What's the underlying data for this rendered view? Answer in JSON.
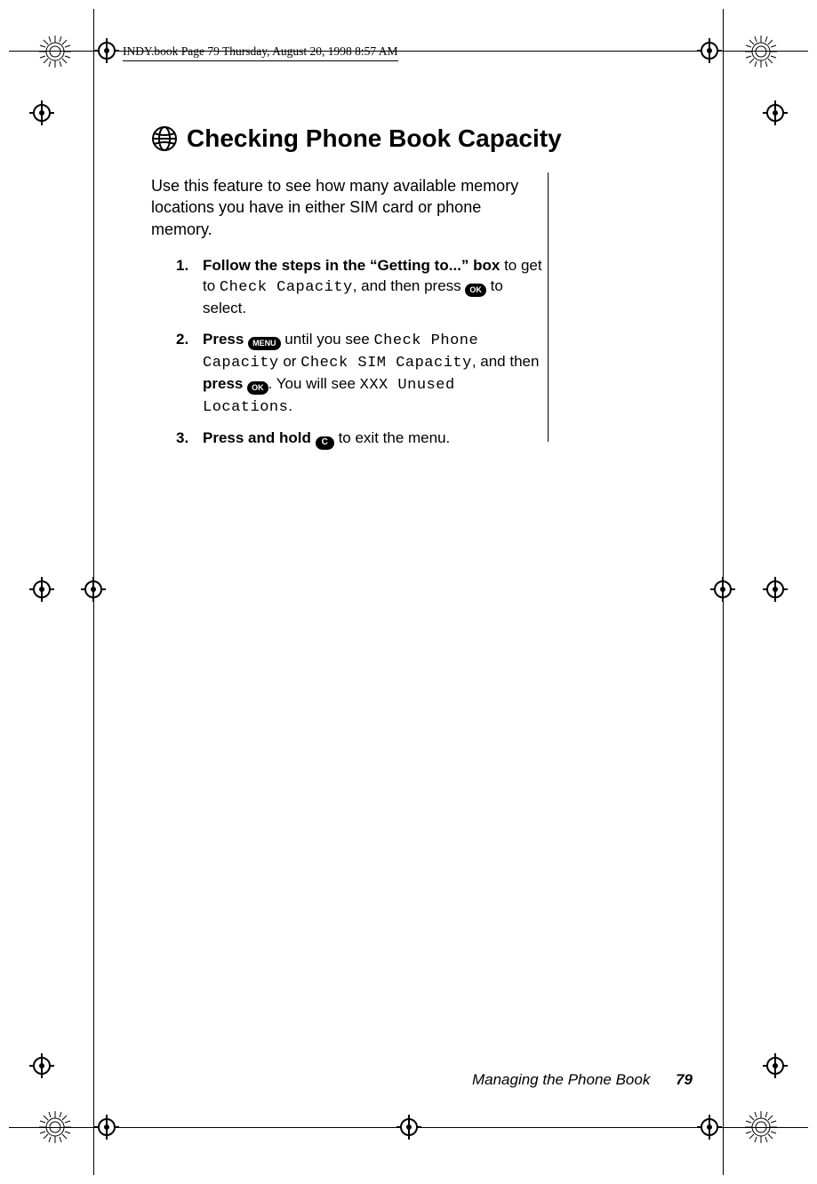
{
  "running_header": "INDY.book  Page 79  Thursday, August 20, 1998  8:57 AM",
  "heading": "Checking Phone Book Capacity",
  "intro": "Use this feature to see how many available memory locations you have in either SIM card or phone memory.",
  "steps": {
    "s1": {
      "num": "1.",
      "lead_bold": "Follow the steps in the “Getting to...” box",
      "t1": " to get to ",
      "lcd1": "Check Capacity",
      "t2": ", and then press ",
      "key": "OK",
      "t3": " to  select."
    },
    "s2": {
      "num": "2.",
      "lead_bold": "Press",
      "key1": "MENU",
      "t1": " until you see ",
      "lcd1": "Check Phone Capacity",
      "t2": " or ",
      "lcd2": "Check SIM Capacity",
      "t3": ", and then ",
      "press_bold": "press",
      "key2": "OK",
      "t4": ". You will see ",
      "lcd3": "XXX Unused Locations",
      "t5": "."
    },
    "s3": {
      "num": "3.",
      "lead_bold": "Press and hold",
      "key": "C",
      "t1": " to exit the menu."
    }
  },
  "footer": {
    "section": "Managing the Phone Book",
    "page": "79"
  }
}
